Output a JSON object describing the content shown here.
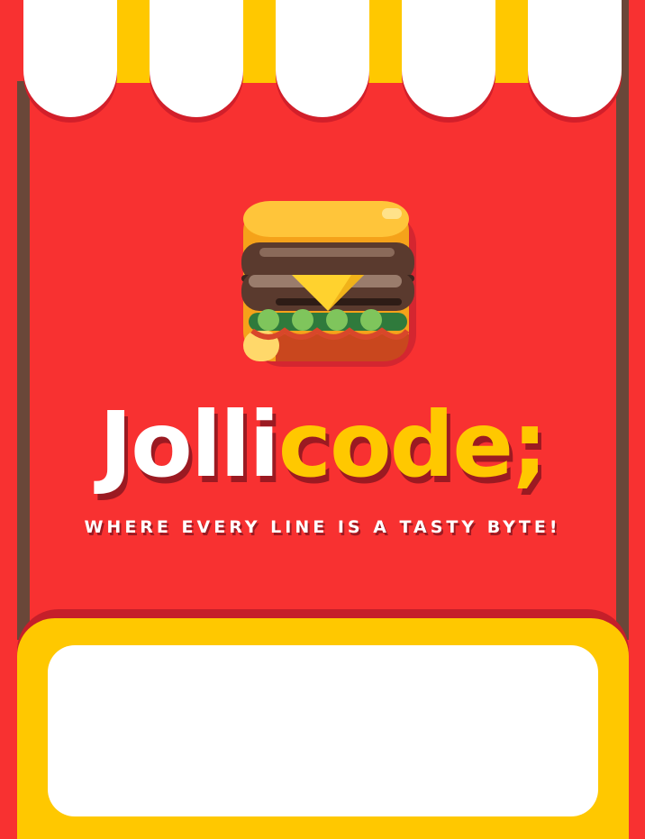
{
  "brand": {
    "name_part1": "Jolli",
    "name_part2": "code;",
    "tagline": "WHERE EVERY LINE IS A TASTY BYTE!"
  },
  "logo": {
    "icon": "burger-icon"
  },
  "colors": {
    "red": "#f83131",
    "yellow": "#ffc800",
    "white": "#ffffff",
    "brown": "#6a4739",
    "shadow": "#9b1a22"
  },
  "sign": {
    "content": ""
  }
}
